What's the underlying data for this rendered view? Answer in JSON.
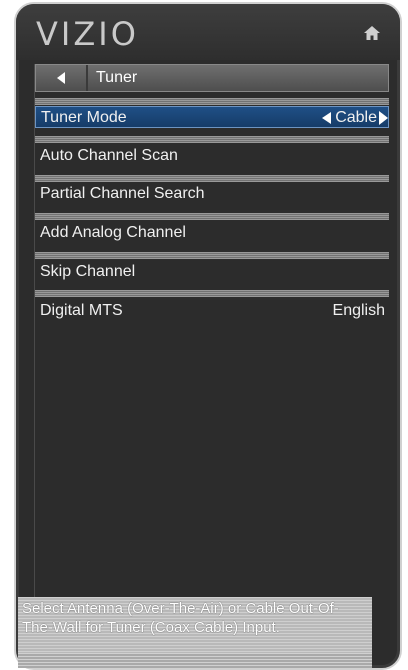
{
  "brand": {
    "logo_text": "VIZIO"
  },
  "header": {
    "home_icon": "home-icon"
  },
  "breadcrumb": {
    "label": "Tuner",
    "back_icon": "back-arrow-icon"
  },
  "menu": {
    "items": [
      {
        "label": "Tuner Mode",
        "value": "Cable",
        "selected": true
      },
      {
        "label": "Auto Channel Scan",
        "value": ""
      },
      {
        "label": "Partial Channel Search",
        "value": ""
      },
      {
        "label": "Add Analog Channel",
        "value": ""
      },
      {
        "label": "Skip Channel",
        "value": ""
      },
      {
        "label": "Digital MTS",
        "value": "English"
      }
    ]
  },
  "help": {
    "text": "Select Antenna (Over-The-Air) or Cable Out-Of-The-Wall for Tuner (Coax Cable) Input."
  },
  "colors": {
    "selected": "#1f4f86",
    "frame": "#2c2c2c"
  }
}
